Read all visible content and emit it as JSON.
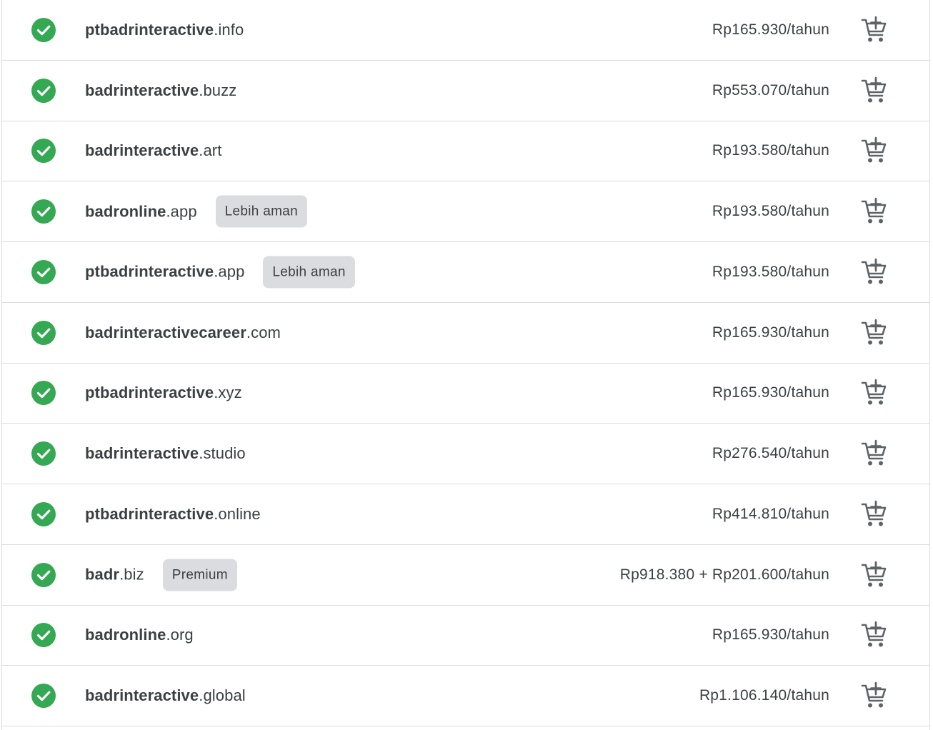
{
  "domains": [
    {
      "sld": "ptbadrinteractive",
      "tld": ".info",
      "badge": "",
      "price": "Rp165.930/tahun"
    },
    {
      "sld": "badrinteractive",
      "tld": ".buzz",
      "badge": "",
      "price": "Rp553.070/tahun"
    },
    {
      "sld": "badrinteractive",
      "tld": ".art",
      "badge": "",
      "price": "Rp193.580/tahun"
    },
    {
      "sld": "badronline",
      "tld": ".app",
      "badge": "Lebih aman",
      "price": "Rp193.580/tahun"
    },
    {
      "sld": "ptbadrinteractive",
      "tld": ".app",
      "badge": "Lebih aman",
      "price": "Rp193.580/tahun"
    },
    {
      "sld": "badrinteractivecareer",
      "tld": ".com",
      "badge": "",
      "price": "Rp165.930/tahun"
    },
    {
      "sld": "ptbadrinteractive",
      "tld": ".xyz",
      "badge": "",
      "price": "Rp165.930/tahun"
    },
    {
      "sld": "badrinteractive",
      "tld": ".studio",
      "badge": "",
      "price": "Rp276.540/tahun"
    },
    {
      "sld": "ptbadrinteractive",
      "tld": ".online",
      "badge": "",
      "price": "Rp414.810/tahun"
    },
    {
      "sld": "badr",
      "tld": ".biz",
      "badge": "Premium",
      "price": "Rp918.380 + Rp201.600/tahun"
    },
    {
      "sld": "badronline",
      "tld": ".org",
      "badge": "",
      "price": "Rp165.930/tahun"
    },
    {
      "sld": "badrinteractive",
      "tld": ".global",
      "badge": "",
      "price": "Rp1.106.140/tahun"
    }
  ],
  "colors": {
    "available_green": "#34a853",
    "text": "#3c4043",
    "badge_bg": "#dadce0",
    "divider": "#dadce0",
    "cart_icon": "#5f6368"
  },
  "icons": {
    "status": "check-circle-icon",
    "action": "add-shopping-cart-icon"
  }
}
